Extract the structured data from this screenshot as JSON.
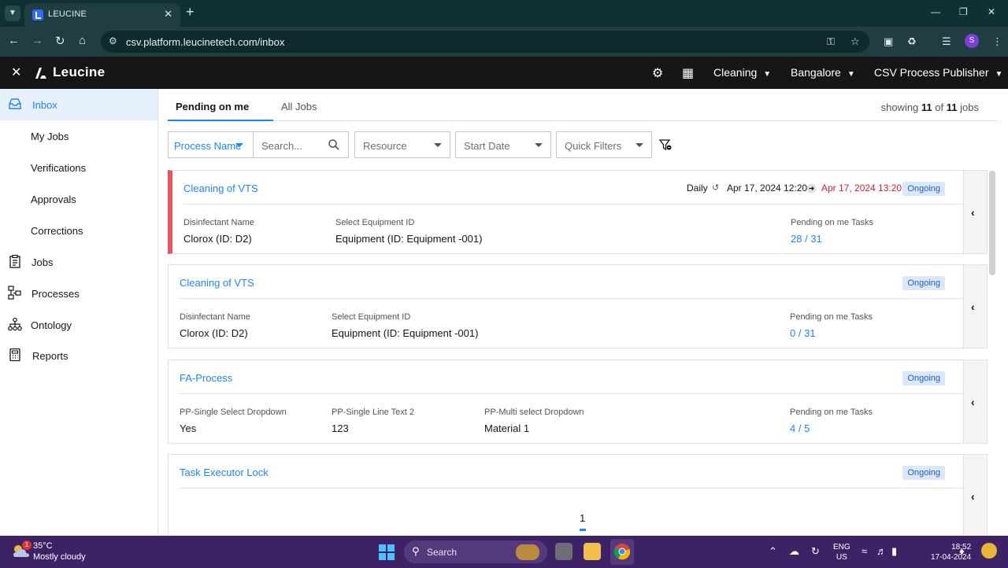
{
  "browser": {
    "tab_title": "LEUCINE",
    "url": "csv.platform.leucinetech.com/inbox",
    "profile_initial": "S"
  },
  "header": {
    "brand": "Leucine",
    "use_case": "Cleaning",
    "facility": "Bangalore",
    "role": "CSV Process Publisher"
  },
  "sidebar": {
    "items": [
      {
        "label": "Inbox",
        "icon": "inbox-icon"
      },
      {
        "label": "My Jobs"
      },
      {
        "label": "Verifications"
      },
      {
        "label": "Approvals"
      },
      {
        "label": "Corrections"
      },
      {
        "label": "Jobs",
        "icon": "clipboard-icon"
      },
      {
        "label": "Processes",
        "icon": "process-icon"
      },
      {
        "label": "Ontology",
        "icon": "ontology-icon"
      },
      {
        "label": "Reports",
        "icon": "report-icon"
      }
    ]
  },
  "tabs": {
    "pending": "Pending on me",
    "all_jobs": "All Jobs"
  },
  "showing": {
    "prefix": "showing",
    "count": "11",
    "of": "of",
    "total": "11",
    "suffix": "jobs"
  },
  "filters": {
    "process_name": "Process Name",
    "search_placeholder": "Search...",
    "resource": "Resource",
    "start_date": "Start Date",
    "quick_filters": "Quick Filters"
  },
  "jobs": [
    {
      "title": "Cleaning of VTS",
      "status": "Ongoing",
      "schedule": {
        "frequency": "Daily",
        "start": "Apr 17, 2024 12:20",
        "end": "Apr 17, 2024 13:20"
      },
      "fields": [
        {
          "label": "Disinfectant Name",
          "value": "Clorox (ID: D2)"
        },
        {
          "label": "Select Equipment ID",
          "value": "Equipment (ID: Equipment -001)"
        }
      ],
      "pending_label": "Pending on me Tasks",
      "pending_value": "28 / 31"
    },
    {
      "title": "Cleaning of VTS",
      "status": "Ongoing",
      "fields": [
        {
          "label": "Disinfectant Name",
          "value": "Clorox (ID: D2)"
        },
        {
          "label": "Select Equipment ID",
          "value": "Equipment (ID: Equipment -001)"
        }
      ],
      "pending_label": "Pending on me Tasks",
      "pending_value": "0 / 31"
    },
    {
      "title": "FA-Process",
      "status": "Ongoing",
      "fields": [
        {
          "label": "PP-Single Select Dropdown",
          "value": "Yes"
        },
        {
          "label": "PP-Single Line Text 2",
          "value": "123"
        },
        {
          "label": "PP-Multi select Dropdown",
          "value": "Material 1"
        }
      ],
      "pending_label": "Pending on me Tasks",
      "pending_value": "4 / 5"
    },
    {
      "title": "Task Executor Lock",
      "status": "Ongoing"
    }
  ],
  "pagination": {
    "current": "1"
  },
  "taskbar": {
    "temperature": "35°C",
    "weather": "Mostly cloudy",
    "weather_badge": "1",
    "search": "Search",
    "lang_1": "ENG",
    "lang_2": "US",
    "time": "18:52",
    "date": "17-04-2024"
  }
}
